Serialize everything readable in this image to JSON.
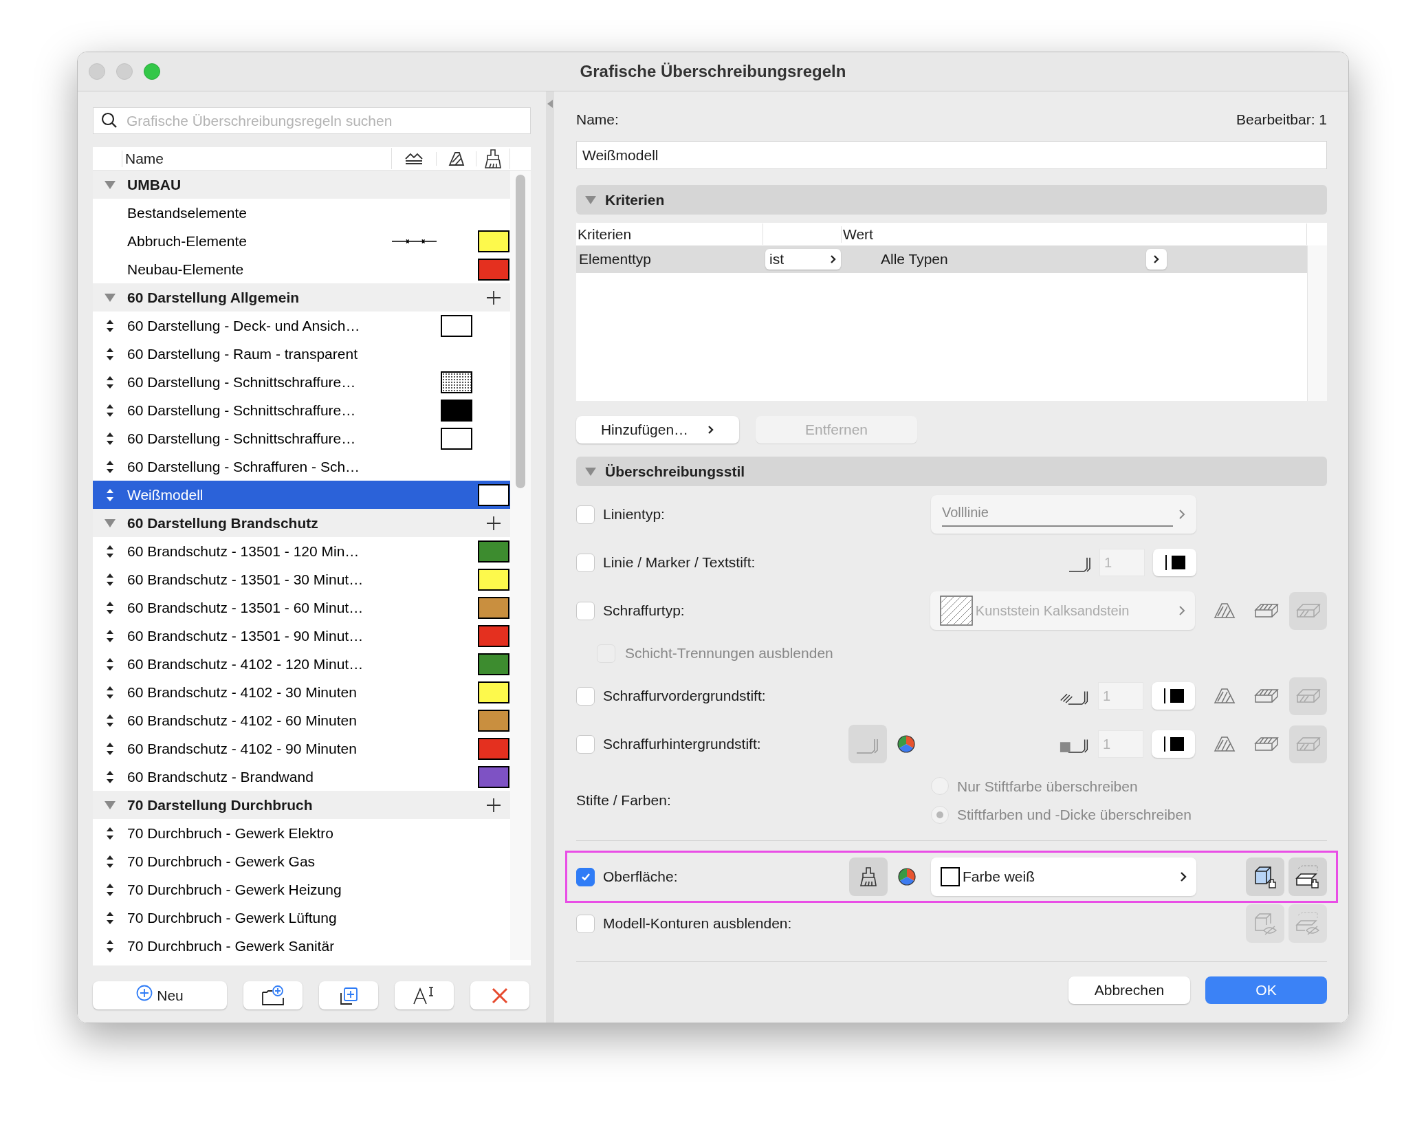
{
  "window": {
    "title": "Grafische Überschreibungsregeln"
  },
  "search": {
    "placeholder": "Grafische Überschreibungsregeln suchen"
  },
  "list": {
    "columns": [
      "Name"
    ],
    "groups": [
      {
        "label": "UMBAU",
        "expanded": true,
        "can_add": false,
        "items": [
          {
            "label": "Bestandselemente",
            "draggable": false,
            "selected": false
          },
          {
            "label": "Abbruch-Elemente",
            "draggable": false,
            "selected": false,
            "line_marker": true,
            "surface": {
              "color": "#fdf94c"
            }
          },
          {
            "label": "Neubau-Elemente",
            "draggable": false,
            "selected": false,
            "surface": {
              "color": "#e4301f"
            }
          }
        ]
      },
      {
        "label": "60 Darstellung Allgemein",
        "expanded": true,
        "can_add": true,
        "items": [
          {
            "label": "60 Darstellung - Deck- und Ansich…",
            "draggable": true,
            "selected": false,
            "hatch": {
              "color": "#ffffff"
            }
          },
          {
            "label": "60 Darstellung - Raum - transparent",
            "draggable": true,
            "selected": false
          },
          {
            "label": "60 Darstellung - Schnittschraffure…",
            "draggable": true,
            "selected": false,
            "hatch": {
              "color": "#ffffff",
              "dotted": true
            }
          },
          {
            "label": "60 Darstellung - Schnittschraffure…",
            "draggable": true,
            "selected": false,
            "hatch": {
              "color": "#000000"
            }
          },
          {
            "label": "60 Darstellung - Schnittschraffure…",
            "draggable": true,
            "selected": false,
            "hatch": {
              "color": "#ffffff"
            }
          },
          {
            "label": "60 Darstellung - Schraffuren - Sch…",
            "draggable": true,
            "selected": false
          },
          {
            "label": "Weißmodell",
            "draggable": true,
            "selected": true,
            "surface": {
              "color": "#ffffff"
            }
          }
        ]
      },
      {
        "label": "60 Darstellung Brandschutz",
        "expanded": true,
        "can_add": true,
        "items": [
          {
            "label": "60 Brandschutz - 13501 - 120 Min…",
            "draggable": true,
            "selected": false,
            "surface": {
              "color": "#3d8c2f"
            }
          },
          {
            "label": "60 Brandschutz - 13501 - 30 Minut…",
            "draggable": true,
            "selected": false,
            "surface": {
              "color": "#fdf94c"
            }
          },
          {
            "label": "60 Brandschutz - 13501 - 60 Minut…",
            "draggable": true,
            "selected": false,
            "surface": {
              "color": "#c98f3f"
            }
          },
          {
            "label": "60 Brandschutz - 13501 - 90 Minut…",
            "draggable": true,
            "selected": false,
            "surface": {
              "color": "#e4301f"
            }
          },
          {
            "label": "60 Brandschutz - 4102 - 120 Minut…",
            "draggable": true,
            "selected": false,
            "surface": {
              "color": "#3d8c2f"
            }
          },
          {
            "label": "60 Brandschutz - 4102 - 30 Minuten",
            "draggable": true,
            "selected": false,
            "surface": {
              "color": "#fdf94c"
            }
          },
          {
            "label": "60 Brandschutz - 4102 - 60 Minuten",
            "draggable": true,
            "selected": false,
            "surface": {
              "color": "#c98f3f"
            }
          },
          {
            "label": "60 Brandschutz - 4102 - 90 Minuten",
            "draggable": true,
            "selected": false,
            "surface": {
              "color": "#e4301f"
            }
          },
          {
            "label": "60 Brandschutz - Brandwand",
            "draggable": true,
            "selected": false,
            "surface": {
              "color": "#7e52c4"
            }
          }
        ]
      },
      {
        "label": "70 Darstellung Durchbruch",
        "expanded": true,
        "can_add": true,
        "items": [
          {
            "label": "70 Durchbruch - Gewerk Elektro",
            "draggable": true,
            "selected": false
          },
          {
            "label": "70 Durchbruch - Gewerk Gas",
            "draggable": true,
            "selected": false
          },
          {
            "label": "70 Durchbruch - Gewerk Heizung",
            "draggable": true,
            "selected": false
          },
          {
            "label": "70 Durchbruch - Gewerk Lüftung",
            "draggable": true,
            "selected": false
          },
          {
            "label": "70 Durchbruch - Gewerk Sanitär",
            "draggable": true,
            "selected": false
          }
        ]
      }
    ]
  },
  "list_buttons": {
    "new": "Neu"
  },
  "name_field": {
    "label": "Name:",
    "value": "Weißmodell",
    "editable": "Bearbeitbar: 1"
  },
  "criteria": {
    "title": "Kriterien",
    "expanded": true,
    "columns": [
      "Kriterien",
      "Wert"
    ],
    "rows": [
      {
        "criterion": "Elementtyp",
        "operator": "ist",
        "value": "Alle Typen",
        "selected": true
      }
    ],
    "add_button": "Hinzufügen…",
    "remove_button": {
      "label": "Entfernen",
      "disabled": true
    }
  },
  "style": {
    "title": "Überschreibungsstil",
    "expanded": true,
    "rows": [
      {
        "kind": "linetype",
        "label": "Linientyp:",
        "checked": false,
        "value": "Volllinie"
      },
      {
        "kind": "pen",
        "label": "Linie / Marker / Textstift:",
        "checked": false,
        "pen": {
          "kind": "plain",
          "number": "1"
        },
        "apply_options": false
      },
      {
        "kind": "fill",
        "label": "Schraffurtyp:",
        "checked": false,
        "value": "Kunststein Kalksandstein"
      },
      {
        "kind": "sub_option",
        "label": "Schicht-Trennungen ausblenden",
        "checked": false,
        "disabled": true
      },
      {
        "kind": "pen",
        "label": "Schraffurvordergrundstift:",
        "checked": false,
        "pen": {
          "kind": "hatch",
          "number": "1"
        },
        "apply_options": true
      },
      {
        "kind": "pen",
        "label": "Schraffurhintergrundstift:",
        "checked": false,
        "pen": {
          "kind": "solid",
          "number": "1"
        },
        "apply_options": true,
        "extra_picker": true
      },
      {
        "kind": "radio_group",
        "label": "Stifte / Farben:",
        "disabled": true,
        "options": [
          {
            "label": "Nur Stiftfarbe überschreiben",
            "selected": false
          },
          {
            "label": "Stiftfarben und -Dicke überschreiben",
            "selected": true
          }
        ]
      },
      {
        "kind": "surface",
        "label": "Oberfläche:",
        "checked": true,
        "value": "Farbe weiß",
        "highlighted": true
      },
      {
        "kind": "hide_contours",
        "label": "Modell-Konturen ausblenden:",
        "checked": false
      }
    ]
  },
  "footer": {
    "cancel": "Abbrechen",
    "ok": "OK"
  }
}
